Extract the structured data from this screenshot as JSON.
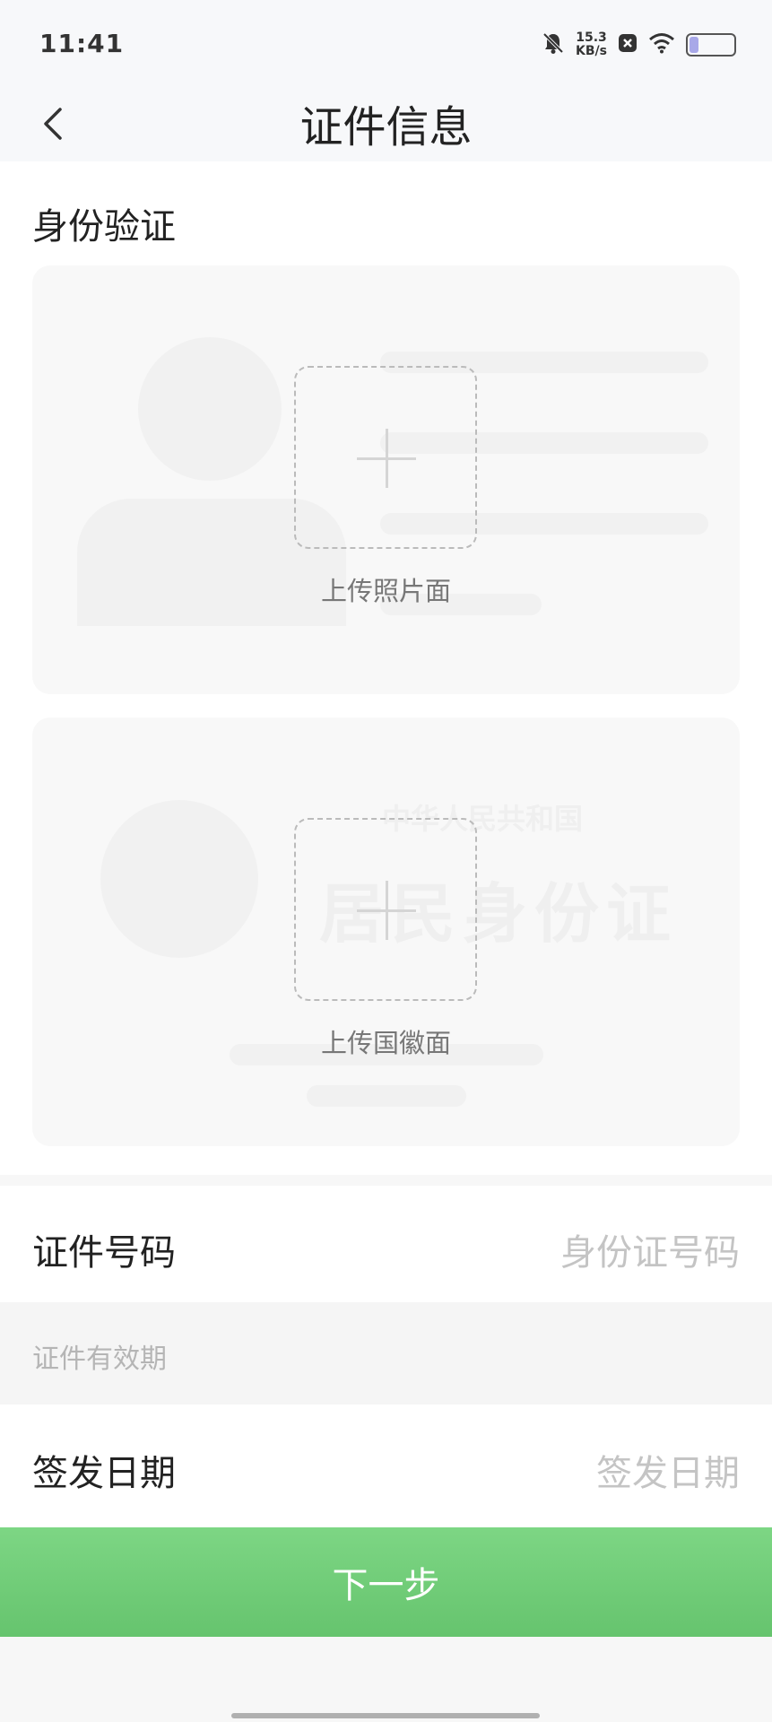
{
  "status_bar": {
    "time": "11:41",
    "net_speed_value": "15.3",
    "net_speed_unit": "KB/s",
    "icons": [
      "bell-off-icon",
      "notification-close-icon",
      "wifi-icon",
      "battery-icon"
    ],
    "battery_level": 0.2
  },
  "header": {
    "title": "证件信息",
    "back_icon": "chevron-left-icon"
  },
  "identity": {
    "section_title": "身份验证",
    "front": {
      "label": "上传照片面",
      "icon": "plus-icon"
    },
    "back": {
      "label": "上传国徽面",
      "icon": "plus-icon",
      "watermark_line1": "中华人民共和国",
      "watermark_line2": "居民身份证"
    }
  },
  "form": {
    "id_number": {
      "label": "证件号码",
      "placeholder": "身份证号码"
    },
    "validity_group": {
      "label": "证件有效期"
    },
    "issue_date": {
      "label": "签发日期",
      "placeholder": "签发日期"
    }
  },
  "footer": {
    "next_button": "下一步"
  },
  "colors": {
    "accent": "#6ccb74",
    "page_bg": "#f7f7f7",
    "placeholder": "#c4c4c4"
  }
}
